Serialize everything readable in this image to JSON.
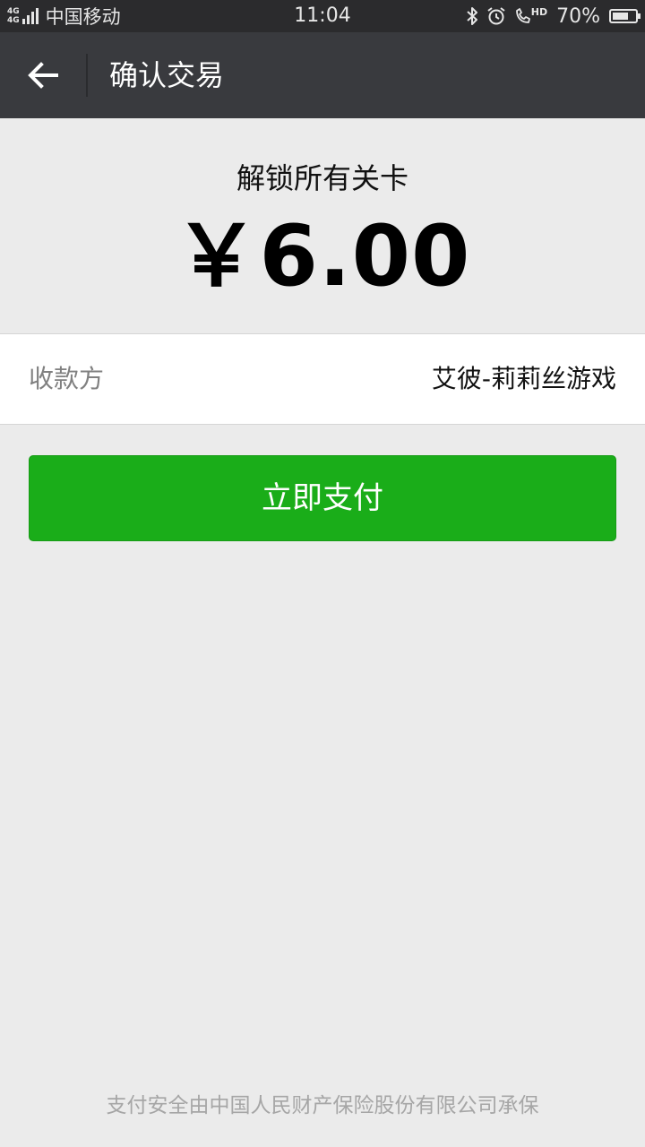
{
  "status_bar": {
    "network_tag_1": "4G",
    "network_tag_2": "4G",
    "carrier": "中国移动",
    "time": "11:04",
    "hd_label": "HD",
    "battery_percent": "70%",
    "battery_level": 0.7,
    "icons": [
      "bluetooth-icon",
      "alarm-icon",
      "hd-call-icon",
      "battery-icon"
    ]
  },
  "nav": {
    "back_icon": "arrow-left-icon",
    "title": "确认交易"
  },
  "order": {
    "product_name": "解锁所有关卡",
    "price": "￥6.00"
  },
  "payee": {
    "label": "收款方",
    "value": "艾彼-莉莉丝游戏"
  },
  "actions": {
    "pay_label": "立即支付"
  },
  "footer": {
    "note": "支付安全由中国人民财产保险股份有限公司承保"
  },
  "colors": {
    "nav_background": "#393a3e",
    "page_background": "#ebebeb",
    "pay_button": "#1aad19"
  }
}
